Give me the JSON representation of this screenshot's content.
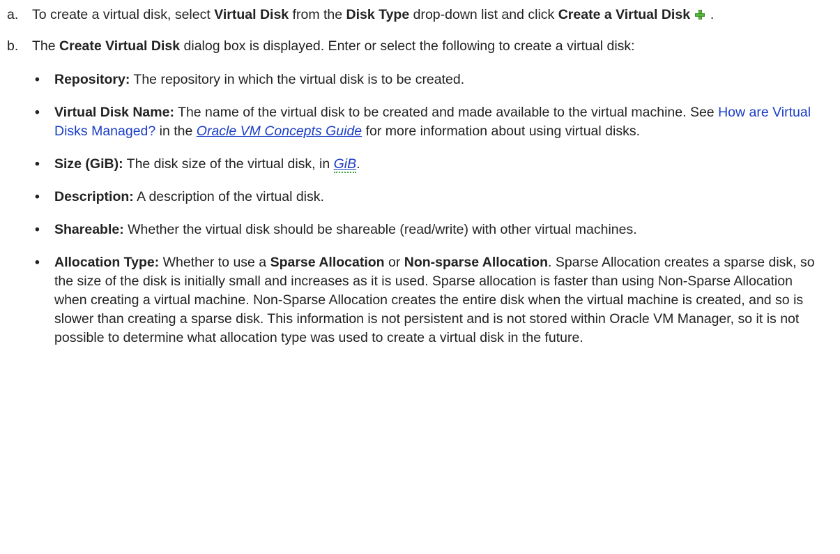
{
  "steps": [
    {
      "marker": "a.",
      "t1": "To create a virtual disk, select ",
      "b1": "Virtual Disk",
      "t2": " from the ",
      "b2": "Disk Type",
      "t3": " drop-down list and click ",
      "b3": "Create a Virtual Disk",
      "icon": "plus-icon",
      "t4": " ."
    },
    {
      "marker": "b.",
      "t1": "The ",
      "b1": "Create Virtual Disk",
      "t2": " dialog box is displayed. Enter or select the following to create a virtual disk:"
    }
  ],
  "bullet_char": "•",
  "fields": [
    {
      "label": "Repository:",
      "text": " The repository in which the virtual disk is to be created."
    },
    {
      "label": "Virtual Disk Name:",
      "text1": " The name of the virtual disk to be created and made available to the virtual machine.  See ",
      "link": "How are Virtual Disks Managed?",
      "text2": " in the ",
      "guide": "Oracle VM Concepts Guide",
      "text3": " for more information about using virtual disks."
    },
    {
      "label": "Size (GiB):",
      "text1": " The disk size of the virtual disk, in ",
      "glossary": "GiB",
      "text2": "."
    },
    {
      "label": "Description:",
      "text": " A description of the virtual disk."
    },
    {
      "label": "Shareable:",
      "text": " Whether the virtual disk should be shareable (read/write) with other virtual machines."
    },
    {
      "label": "Allocation Type:",
      "text1": " Whether to use a ",
      "opt1": "Sparse Allocation",
      "text2": " or ",
      "opt2": "Non-sparse Allocation",
      "text3": ". Sparse Allocation creates a sparse disk, so the size of the disk is initially small and increases as it is used. Sparse allocation is faster than using Non-Sparse Allocation when creating a virtual machine. Non-Sparse Allocation creates the entire disk when the virtual machine is created, and so is slower than creating a sparse disk. This information is not persistent and is not stored within Oracle VM Manager, so it is not possible to determine what allocation type was used to create a virtual disk in the future."
    }
  ],
  "colors": {
    "text": "#222222",
    "link": "#1a3ec7",
    "icon_green": "#55b83a",
    "glossary_underline": "#3aa13a"
  }
}
